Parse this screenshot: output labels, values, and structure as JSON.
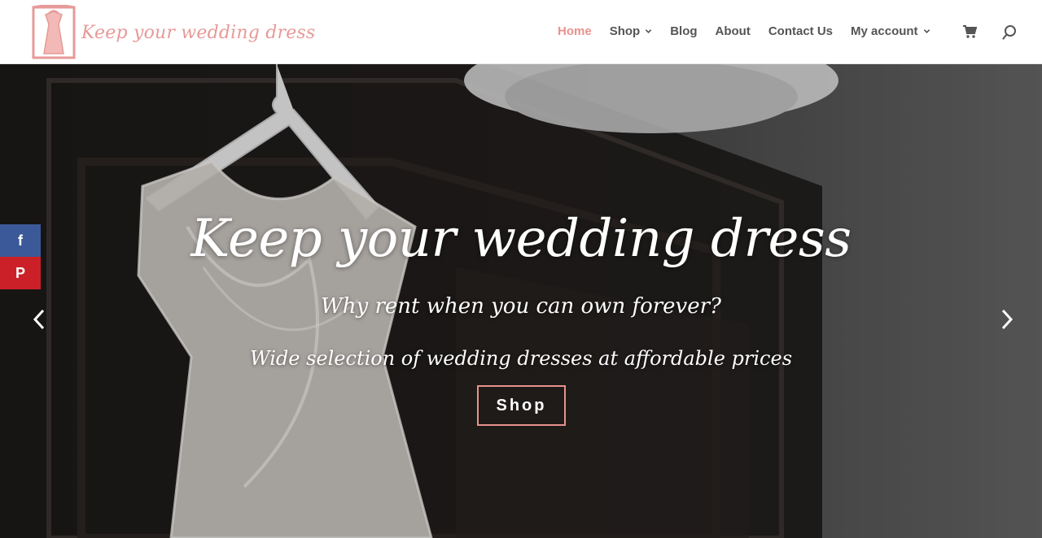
{
  "site": {
    "logo_text": "Keep your wedding dress"
  },
  "nav": {
    "items": [
      {
        "label": "Home",
        "active": true,
        "dropdown": false
      },
      {
        "label": "Shop",
        "active": false,
        "dropdown": true
      },
      {
        "label": "Blog",
        "active": false,
        "dropdown": false
      },
      {
        "label": "About",
        "active": false,
        "dropdown": false
      },
      {
        "label": "Contact Us",
        "active": false,
        "dropdown": false
      },
      {
        "label": "My account",
        "active": false,
        "dropdown": true
      }
    ],
    "icons": [
      "cart-icon",
      "search-icon"
    ]
  },
  "hero": {
    "title": "Keep your wedding dress",
    "subtitle": "Why rent when you can own forever?",
    "description": "Wide selection of wedding dresses at affordable prices",
    "button_label": "Shop"
  },
  "social": {
    "facebook_glyph": "f",
    "pinterest_glyph": "P"
  },
  "colors": {
    "accent": "#e8928e",
    "logo": "#e69a98",
    "facebook": "#3b5998",
    "pinterest": "#cb2027"
  }
}
